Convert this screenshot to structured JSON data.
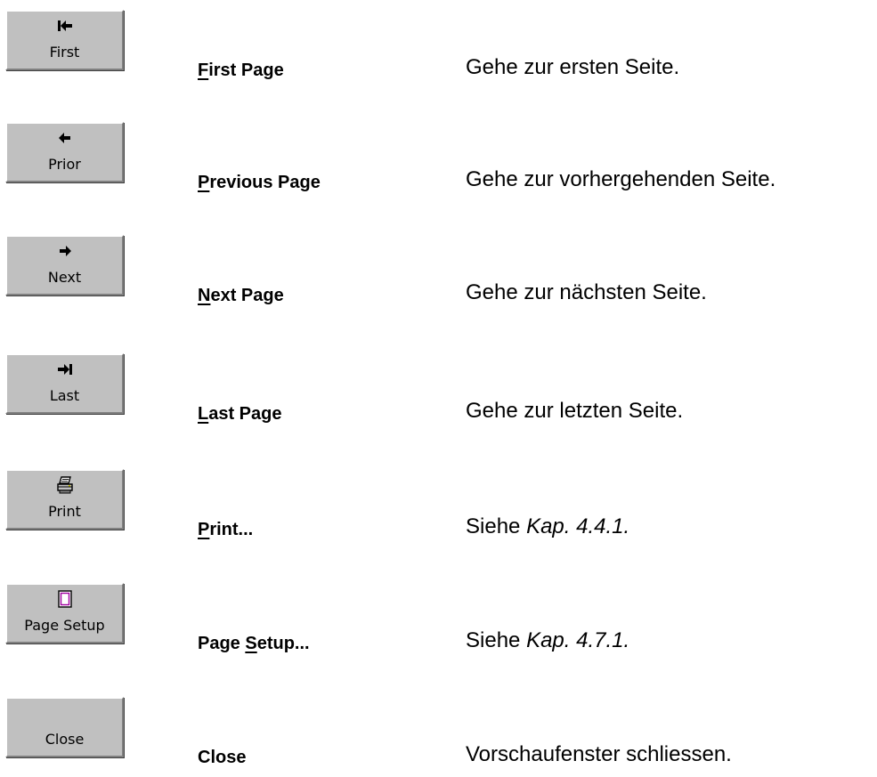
{
  "rows": [
    {
      "button_label": "First",
      "icon": "first-page-icon",
      "cmd_pre": "",
      "cmd_key": "F",
      "cmd_post": "irst Page",
      "desc": "Gehe zur ersten Seite.",
      "desc_ref": ""
    },
    {
      "button_label": "Prior",
      "icon": "left-arrow-icon",
      "cmd_pre": "",
      "cmd_key": "P",
      "cmd_post": "revious Page",
      "desc": "Gehe zur vorhergehenden Seite.",
      "desc_ref": ""
    },
    {
      "button_label": "Next",
      "icon": "right-arrow-icon",
      "cmd_pre": "",
      "cmd_key": "N",
      "cmd_post": "ext Page",
      "desc": "Gehe zur nächsten Seite.",
      "desc_ref": ""
    },
    {
      "button_label": "Last",
      "icon": "last-page-icon",
      "cmd_pre": "",
      "cmd_key": "L",
      "cmd_post": "ast Page",
      "desc": "Gehe zur letzten Seite.",
      "desc_ref": ""
    },
    {
      "button_label": "Print",
      "icon": "printer-icon",
      "cmd_pre": "",
      "cmd_key": "P",
      "cmd_post": "rint...",
      "desc": "Siehe ",
      "desc_ref": "Kap. 4.4.1."
    },
    {
      "button_label": "Page Setup",
      "icon": "page-setup-icon",
      "cmd_pre": "Page ",
      "cmd_key": "S",
      "cmd_post": "etup...",
      "desc": "Siehe ",
      "desc_ref": "Kap. 4.7.1."
    },
    {
      "button_label": "Close",
      "icon": "",
      "cmd_pre": "Close",
      "cmd_key": "",
      "cmd_post": "",
      "desc": "Vorschaufenster schliessen.",
      "desc_ref": ""
    }
  ]
}
